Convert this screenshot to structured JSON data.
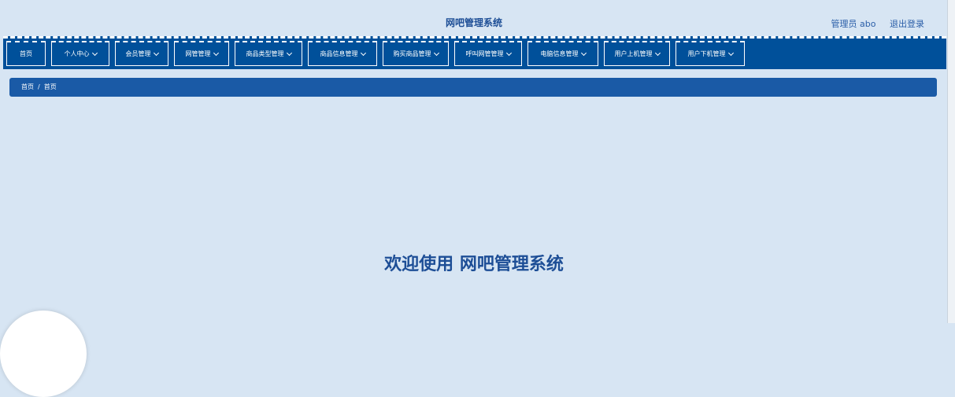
{
  "header": {
    "title": "网吧管理系统",
    "user_label": "管理员 abo",
    "logout_label": "退出登录"
  },
  "nav": {
    "items": [
      {
        "label": "首页",
        "has_dropdown": false
      },
      {
        "label": "个人中心",
        "has_dropdown": true
      },
      {
        "label": "会员管理",
        "has_dropdown": true
      },
      {
        "label": "网管管理",
        "has_dropdown": true
      },
      {
        "label": "商品类型管理",
        "has_dropdown": true
      },
      {
        "label": "商品信息管理",
        "has_dropdown": true
      },
      {
        "label": "购买商品管理",
        "has_dropdown": true
      },
      {
        "label": "呼叫网管管理",
        "has_dropdown": true
      },
      {
        "label": "电脑信息管理",
        "has_dropdown": true
      },
      {
        "label": "用户上机管理",
        "has_dropdown": true
      },
      {
        "label": "用户下机管理",
        "has_dropdown": true
      }
    ]
  },
  "breadcrumb": {
    "items": [
      "首页",
      "首页"
    ],
    "separator": "/"
  },
  "main": {
    "welcome": "欢迎使用 网吧管理系统"
  },
  "colors": {
    "background": "#d7e5f3",
    "navbar": "#00509a",
    "breadcrumb": "#1a5aa6",
    "title_text": "#1d4e96"
  }
}
